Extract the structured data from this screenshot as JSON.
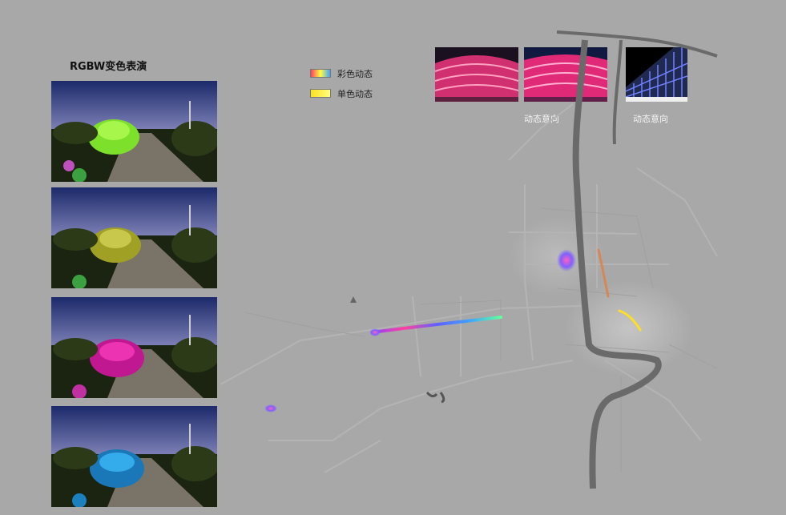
{
  "title": "RGBW变色表演",
  "legend": [
    {
      "label": "彩色动态",
      "icon": "gradient-swatch"
    },
    {
      "label": "单色动态",
      "icon": "yellow-swatch"
    }
  ],
  "photos": [
    {
      "tree_color": "#7de02a",
      "glow": "#b8ff5a"
    },
    {
      "tree_color": "#a0a024",
      "glow": "#d8d860"
    },
    {
      "tree_color": "#c01890",
      "glow": "#ff40c0"
    },
    {
      "tree_color": "#1a78b8",
      "glow": "#40c0ff"
    }
  ],
  "thumbnails": [
    {
      "caption": ""
    },
    {
      "caption": "动态意向"
    },
    {
      "caption": "动态意向"
    }
  ],
  "colors": {
    "background": "#a8a8a8",
    "river": "#6a6a6a",
    "roads": "#b4b4b4",
    "colorful_dynamic": [
      "#ff4060",
      "#ffff40",
      "#40a0ff"
    ],
    "single_dynamic": "#ffe020"
  }
}
